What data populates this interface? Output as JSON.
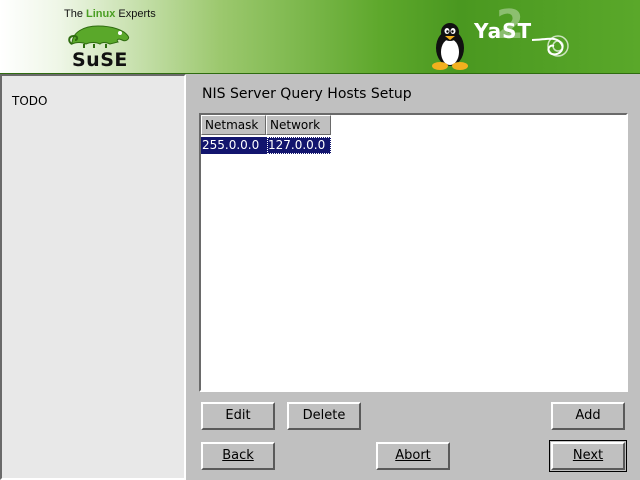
{
  "header": {
    "tagline_prefix": "The ",
    "tagline_mid": "Linux",
    "tagline_suffix": " Experts",
    "brand": "SuSE",
    "product": "YaST",
    "product_version": "2"
  },
  "help": {
    "text": "TODO"
  },
  "dialog": {
    "title": "NIS Server Query Hosts Setup",
    "table": {
      "columns": [
        "Netmask",
        "Network"
      ],
      "rows": [
        {
          "netmask": "255.0.0.0",
          "network": "127.0.0.0",
          "selected": true
        }
      ]
    },
    "buttons": {
      "edit": "Edit",
      "delete": "Delete",
      "add": "Add",
      "back": "Back",
      "abort": "Abort",
      "next": "Next"
    }
  },
  "colors": {
    "banner_green": "#5ea82c",
    "selection": "#12156e",
    "window_bg": "#c0c0c0"
  },
  "icons": [
    "suse-chameleon-icon",
    "tux-penguin-icon",
    "yast-swirl-icon"
  ]
}
